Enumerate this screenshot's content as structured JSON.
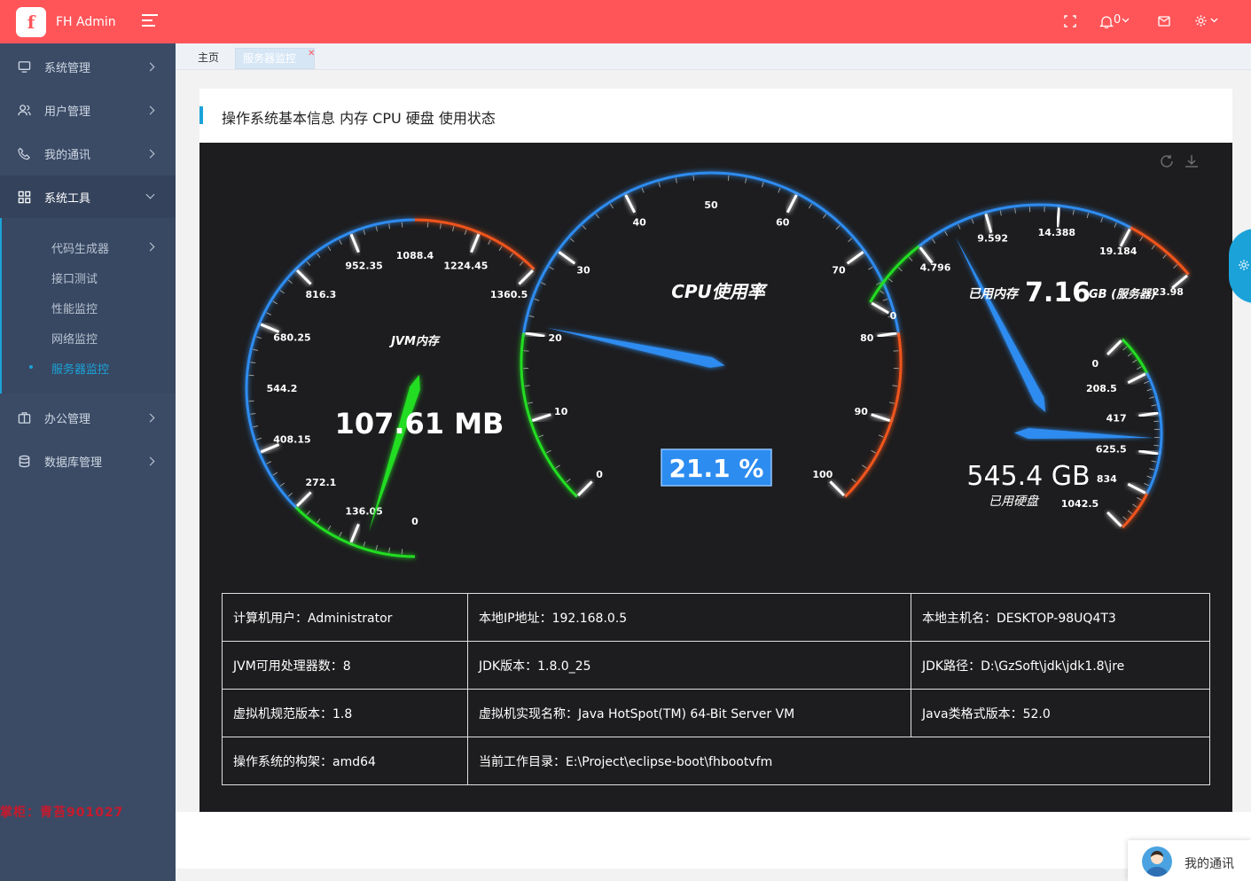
{
  "app": {
    "logo_letter": "f",
    "title": "FH Admin"
  },
  "header": {
    "notify_count": "0"
  },
  "sidebar": {
    "items": [
      {
        "label": "系统管理",
        "icon": "monitor-icon"
      },
      {
        "label": "用户管理",
        "icon": "users-icon"
      },
      {
        "label": "我的通讯",
        "icon": "phone-icon"
      },
      {
        "label": "系统工具",
        "icon": "grid-icon"
      },
      {
        "label": "办公管理",
        "icon": "briefcase-icon"
      },
      {
        "label": "数据库管理",
        "icon": "database-icon"
      }
    ],
    "subitems": [
      "代码生成器",
      "接口测试",
      "性能监控",
      "网络监控",
      "服务器监控"
    ],
    "watermark": "掌柜：青苔901027"
  },
  "tabs": [
    {
      "label": "主页"
    },
    {
      "label": "服务器监控"
    }
  ],
  "section_title": "操作系统基本信息 内存 CPU 硬盘 使用状态",
  "gauges": {
    "jvm": {
      "title": "JVM内存",
      "value_text": "107.61 MB",
      "value": 107.61,
      "ticks": [
        "0",
        "136.05",
        "272.1",
        "408.15",
        "544.2",
        "680.25",
        "816.3",
        "952.35",
        "1088.4",
        "1224.45",
        "1360.5"
      ]
    },
    "cpu": {
      "title": "CPU使用率",
      "value_text": "21.1 %",
      "value": 21.1,
      "ticks": [
        "0",
        "10",
        "20",
        "30",
        "40",
        "50",
        "60",
        "70",
        "80",
        "90",
        "100"
      ]
    },
    "mem": {
      "title_prefix": "已用内存",
      "value_text": "7.16",
      "unit": "GB (服务器)",
      "value": 7.16,
      "ticks": [
        "0",
        "4.796",
        "9.592",
        "14.388",
        "19.184",
        "23.98"
      ]
    },
    "disk": {
      "value_text": "545.4 GB",
      "subtitle": "已用硬盘",
      "value": 545.4,
      "ticks": [
        "0",
        "208.5",
        "417",
        "625.5",
        "834",
        "1042.5"
      ]
    }
  },
  "info": {
    "rows": [
      [
        "计算机用户：Administrator",
        "本地IP地址：192.168.0.5",
        "本地主机名：DESKTOP-98UQ4T3"
      ],
      [
        "JVM可用处理器数：8",
        "JDK版本：1.8.0_25",
        "JDK路径：D:\\GzSoft\\jdk\\jdk1.8\\jre"
      ],
      [
        "虚拟机规范版本：1.8",
        "虚拟机实现名称：Java HotSpot(TM) 64-Bit Server VM",
        "Java类格式版本：52.0"
      ],
      [
        "操作系统的构架：amd64",
        "当前工作目录：E:\\Project\\eclipse-boot\\fhbootvfm",
        ""
      ]
    ]
  },
  "chat": {
    "label": "我的通讯"
  },
  "colors": {
    "brand": "#ff5559",
    "sidebar": "#3b4b66",
    "accent": "#1ba3d9",
    "gauge_blue": "#2d8cf0",
    "gauge_green": "#22dd22",
    "gauge_red": "#f0541e"
  }
}
